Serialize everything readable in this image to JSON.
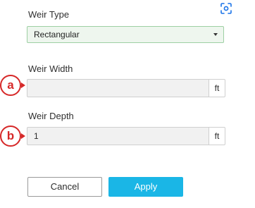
{
  "corner_icon": {
    "name": "screenshot-capture-icon",
    "color": "#1a73e8"
  },
  "weir_type": {
    "label": "Weir Type",
    "selected": "Rectangular"
  },
  "weir_width": {
    "label": "Weir Width",
    "value": "",
    "unit": "ft",
    "marker": "a"
  },
  "weir_depth": {
    "label": "Weir Depth",
    "value": "1",
    "unit": "ft",
    "marker": "b"
  },
  "actions": {
    "cancel_label": "Cancel",
    "apply_label": "Apply"
  },
  "colors": {
    "accent": "#1ab6e6",
    "select_border": "#9dd0a3",
    "marker": "#d62828"
  }
}
